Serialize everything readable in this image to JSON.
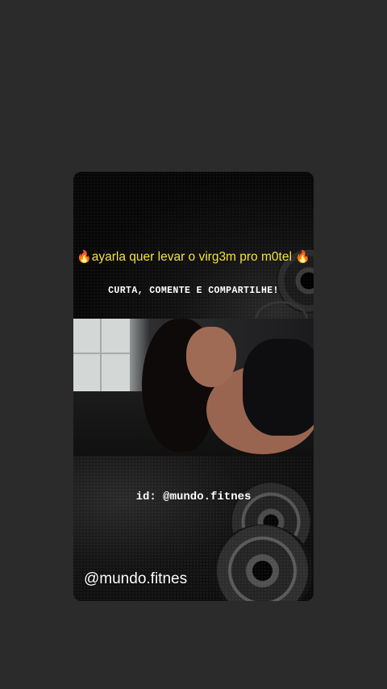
{
  "post": {
    "headline_flame_left": "🔥",
    "headline_text": "ayarla quer levar o virg3m pro m0tel",
    "headline_flame_right": "🔥",
    "cta_text": "CURTA, COMENTE E COMPARTILHE!",
    "id_text": "id: @mundo.fitnes",
    "watermark": "@mundo.fitnes"
  },
  "colors": {
    "background": "#2b2b2b",
    "headline": "#f2e23a",
    "cta": "#ffffff"
  }
}
